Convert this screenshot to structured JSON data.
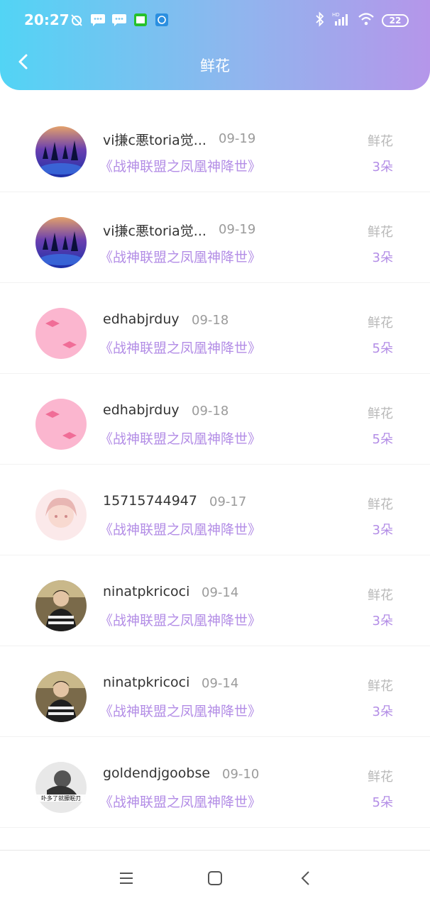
{
  "status_bar": {
    "time": "20:27",
    "battery": "22",
    "hd": "HD"
  },
  "header": {
    "title": "鲜花",
    "back_icon": "chevron-left-icon"
  },
  "colors": {
    "gradient_start": "#52d4f5",
    "gradient_end": "#b596ea",
    "accent_purple": "#b38de6"
  },
  "items": [
    {
      "name": "vi搛c悪toria觉...",
      "date": "09-19",
      "book": "《战神联盟之凤凰神降世》",
      "gift": "鲜花",
      "count": "3朵",
      "avatar": "avatar-night-forest"
    },
    {
      "name": "vi搛c悪toria觉...",
      "date": "09-19",
      "book": "《战神联盟之凤凰神降世》",
      "gift": "鲜花",
      "count": "3朵",
      "avatar": "avatar-night-forest"
    },
    {
      "name": "edhabjrduy",
      "date": "09-18",
      "book": "《战神联盟之凤凰神降世》",
      "gift": "鲜花",
      "count": "5朵",
      "avatar": "avatar-pink-bows"
    },
    {
      "name": "edhabjrduy",
      "date": "09-18",
      "book": "《战神联盟之凤凰神降世》",
      "gift": "鲜花",
      "count": "5朵",
      "avatar": "avatar-pink-bows"
    },
    {
      "name": "15715744947",
      "date": "09-17",
      "book": "《战神联盟之凤凰神降世》",
      "gift": "鲜花",
      "count": "3朵",
      "avatar": "avatar-anime-girl"
    },
    {
      "name": "ninatpkricoci",
      "date": "09-14",
      "book": "《战神联盟之凤凰神降世》",
      "gift": "鲜花",
      "count": "3朵",
      "avatar": "avatar-photo-person"
    },
    {
      "name": "ninatpkricoci",
      "date": "09-14",
      "book": "《战神联盟之凤凰神降世》",
      "gift": "鲜花",
      "count": "3朵",
      "avatar": "avatar-photo-person"
    },
    {
      "name": "goldendjgoobse",
      "date": "09-10",
      "book": "《战神联盟之凤凰神降世》",
      "gift": "鲜花",
      "count": "5朵",
      "avatar": "avatar-bw-photo"
    }
  ],
  "bottom_nav": {
    "menu_icon": "menu-icon",
    "home_icon": "home-square-icon",
    "back_icon": "back-triangle-icon"
  }
}
